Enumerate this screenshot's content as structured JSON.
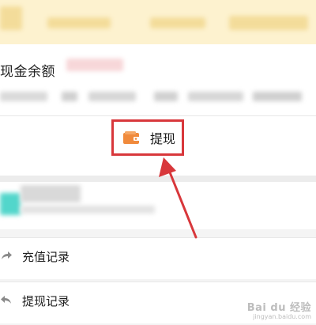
{
  "balance": {
    "label": "现金余额"
  },
  "withdraw": {
    "label": "提现"
  },
  "history": [
    {
      "label": "充值记录",
      "icon": "share-arrow-icon"
    },
    {
      "label": "提现记录",
      "icon": "reply-arrow-icon"
    }
  ],
  "watermark": {
    "logo": "Bai du 经验",
    "url": "jingyan.baidu.com"
  },
  "colors": {
    "highlight": "#d8373b",
    "wallet": "#f08a3c",
    "notice": "#fdf2cf"
  }
}
